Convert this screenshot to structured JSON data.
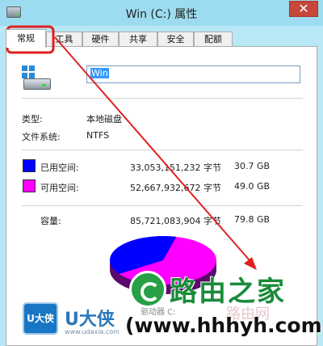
{
  "window": {
    "title": "Win (C:) 属性",
    "close_glyph": "✕"
  },
  "tabs": [
    {
      "label": "常规",
      "active": true
    },
    {
      "label": "工具",
      "active": false
    },
    {
      "label": "硬件",
      "active": false
    },
    {
      "label": "共享",
      "active": false
    },
    {
      "label": "安全",
      "active": false
    },
    {
      "label": "配额",
      "active": false
    }
  ],
  "general": {
    "drive_name": "Win",
    "type_label": "类型:",
    "type_value": "本地磁盘",
    "fs_label": "文件系统:",
    "fs_value": "NTFS",
    "used": {
      "label": "已用空间:",
      "bytes": "33,053,151,232 字节",
      "gb": "30.7 GB",
      "color": "#0000ff"
    },
    "free": {
      "label": "可用空间:",
      "bytes": "52,667,932,672 字节",
      "gb": "49.0 GB",
      "color": "#ff00ff"
    },
    "capacity": {
      "label": "容量:",
      "bytes": "85,721,083,904 字节",
      "gb": "79.8 GB"
    },
    "disk_label": "驱动器 C:"
  },
  "watermark": {
    "brand": "U大侠",
    "brand_url": "www.udaxia.com",
    "brand_icon_text": "U大侠",
    "site_name": "路由之家",
    "site_url": "(www.hhhyh.com)",
    "faint_text": "路由网"
  },
  "annotation_color": "#e02020"
}
